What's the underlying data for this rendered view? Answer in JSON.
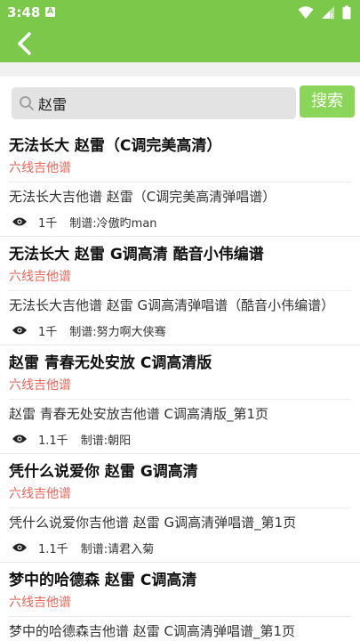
{
  "status": {
    "time": "3:48",
    "notification_glyph": "A",
    "icons": [
      "wifi-icon",
      "signal-icon",
      "battery-icon"
    ]
  },
  "appbar": {
    "back_icon": "chevron-left-icon",
    "accent_color": "#7cc84a"
  },
  "search": {
    "query": "赵雷",
    "placeholder": "",
    "button_label": "搜索",
    "button_color": "#8bd65a"
  },
  "results": [
    {
      "title": "无法长大 赵雷（C调完美高清）",
      "category": "六线吉他谱",
      "description": "无法长大吉他谱 赵雷（C调完美高清弹唱谱）",
      "views": "1千",
      "author": "制谱:冷傲旳man"
    },
    {
      "title": "无法长大 赵雷 G调高清 酷音小伟编谱",
      "category": "六线吉他谱",
      "description": "无法长大吉他谱 赵雷 G调高清弹唱谱（酷音小伟编谱）",
      "views": "1千",
      "author": "制谱:努力啊大侠骞"
    },
    {
      "title": "赵雷 青春无处安放 C调高清版",
      "category": "六线吉他谱",
      "description": "赵雷 青春无处安放吉他谱 C调高清版_第1页",
      "views": "1.1千",
      "author": "制谱:朝阳"
    },
    {
      "title": "凭什么说爱你 赵雷 G调高清",
      "category": "六线吉他谱",
      "description": "凭什么说爱你吉他谱 赵雷 G调高清弹唱谱_第1页",
      "views": "1.1千",
      "author": "制谱:请君入菊"
    },
    {
      "title": "梦中的哈德森 赵雷 C调高清",
      "category": "六线吉他谱",
      "description": "梦中的哈德森吉他谱 赵雷 C调高清弹唱谱_第1页",
      "views": "",
      "author": ""
    }
  ],
  "colors": {
    "category": "#e8665a",
    "divider": "#e9e9e9"
  }
}
